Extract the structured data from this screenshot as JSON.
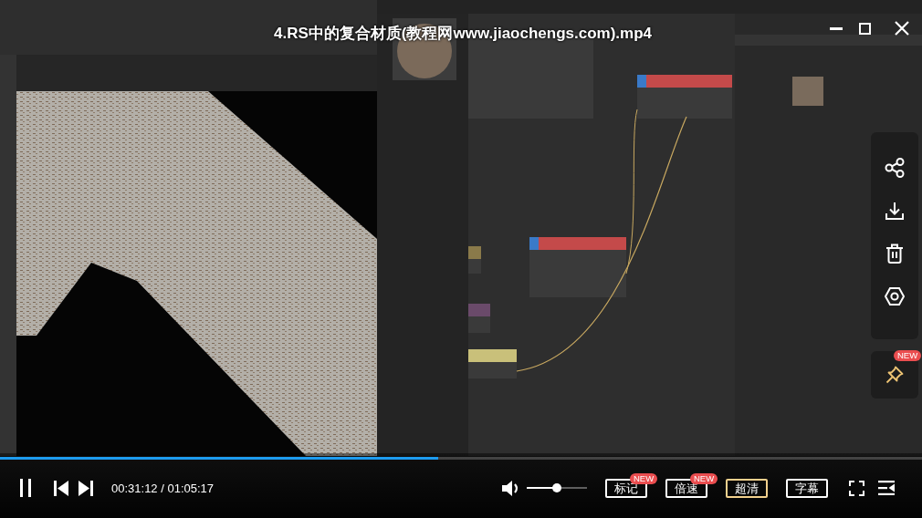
{
  "title": "4.RS中的复合材质(教程网www.jiaochengs.com).mp4",
  "side_panel": {
    "pin_badge": "NEW"
  },
  "progress": {
    "level": 0.475
  },
  "playing": true,
  "time": "00:31:12 / 01:05:17",
  "volume": {
    "level": 0.5
  },
  "buttons": [
    {
      "label": "标记",
      "badge": "NEW",
      "highlighted": false
    },
    {
      "label": "倍速",
      "badge": "NEW",
      "highlighted": false
    },
    {
      "label": "超清",
      "highlighted": true
    },
    {
      "label": "字幕",
      "highlighted": false
    }
  ]
}
